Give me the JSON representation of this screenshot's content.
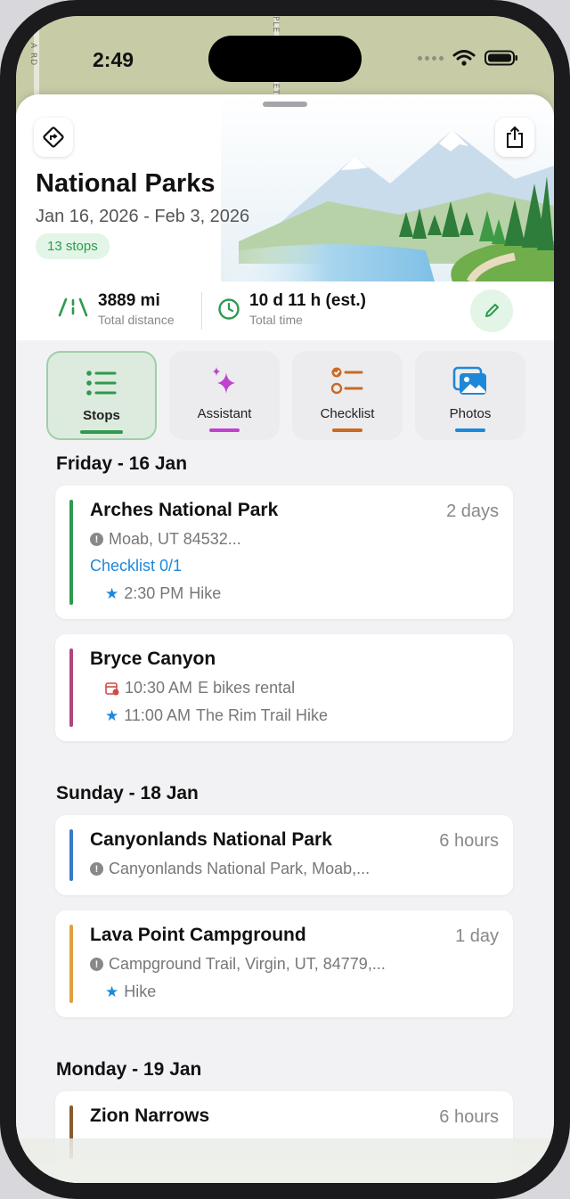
{
  "status_bar": {
    "time": "2:49"
  },
  "map": {
    "road_labels": [
      "A RD",
      "PLE",
      "IET"
    ]
  },
  "trip": {
    "title": "National Parks",
    "dates": "Jan 16, 2026 - Feb 3, 2026",
    "stops_badge": "13 stops"
  },
  "stats": {
    "distance_value": "3889 mi",
    "distance_label": "Total distance",
    "time_value": "10 d 11 h (est.)",
    "time_label": "Total time"
  },
  "tabs": [
    {
      "label": "Stops",
      "icon": "list-icon",
      "color": "#2e9a4f",
      "active": true
    },
    {
      "label": "Assistant",
      "icon": "sparkles-icon",
      "color": "#c040d0",
      "active": false
    },
    {
      "label": "Checklist",
      "icon": "checklist-icon",
      "color": "#c96a25",
      "active": false
    },
    {
      "label": "Photos",
      "icon": "photos-icon",
      "color": "#1e88d8",
      "active": false
    }
  ],
  "days": [
    {
      "header": "Friday - 16 Jan",
      "stops": [
        {
          "name": "Arches National Park",
          "duration": "2 days",
          "address": "Moab, UT 84532...",
          "checklist": "Checklist 0/1",
          "activity_time": "2:30 PM",
          "activity": "Hike",
          "color": "#2e9a4f"
        },
        {
          "name": "Bryce Canyon",
          "rental_time": "10:30 AM",
          "rental": "E bikes rental",
          "activity_time": "11:00 AM",
          "activity": "The Rim Trail Hike",
          "color": "#b0467a"
        }
      ]
    },
    {
      "header": "Sunday - 18 Jan",
      "stops": [
        {
          "name": "Canyonlands National Park",
          "duration": "6 hours",
          "address": "Canyonlands National Park, Moab,...",
          "color": "#3a78c8"
        },
        {
          "name": "Lava Point Campground",
          "duration": "1 day",
          "address": "Campground Trail, Virgin, UT, 84779,...",
          "activity": "Hike",
          "color": "#e0a040"
        }
      ]
    },
    {
      "header": "Monday - 19 Jan",
      "stops": [
        {
          "name": "Zion Narrows",
          "duration": "6 hours",
          "color": "#8a5a30"
        }
      ]
    }
  ]
}
